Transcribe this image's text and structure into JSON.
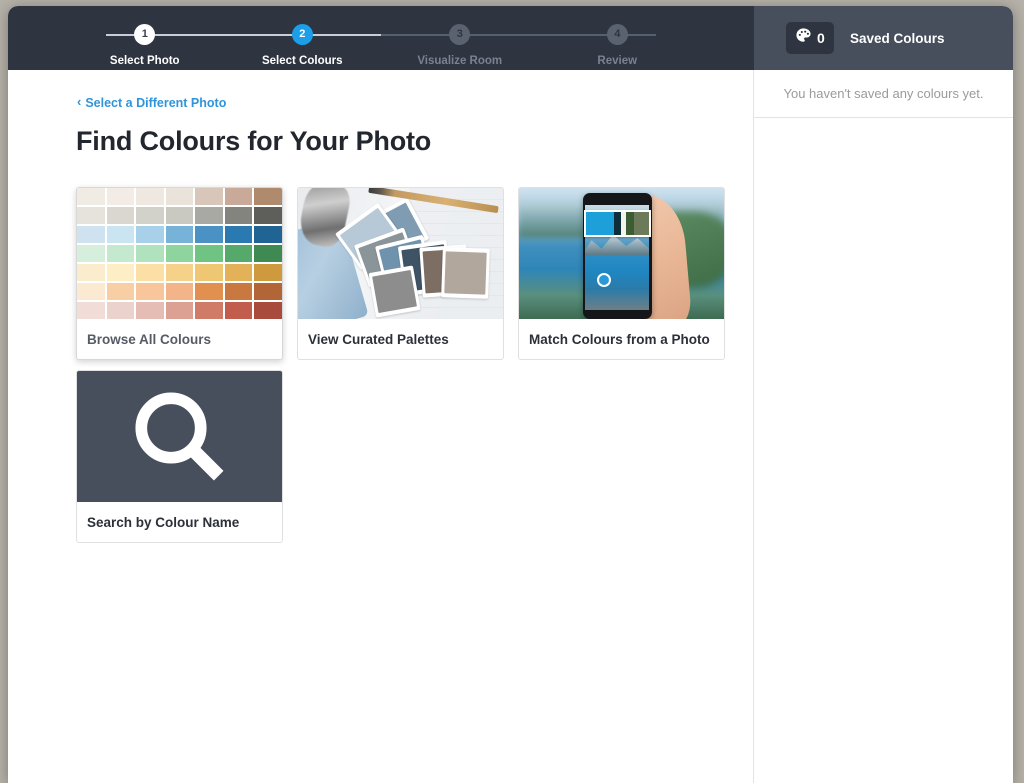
{
  "stepper": {
    "steps": [
      {
        "number": "1",
        "label": "Select Photo",
        "state": "done"
      },
      {
        "number": "2",
        "label": "Select Colours",
        "state": "active"
      },
      {
        "number": "3",
        "label": "Visualize Room",
        "state": "todo"
      },
      {
        "number": "4",
        "label": "Review",
        "state": "todo"
      }
    ],
    "active_color": "#1c9fe8"
  },
  "saved_panel": {
    "icon": "palette-icon",
    "count": "0",
    "title": "Saved Colours",
    "empty_message": "You haven't saved any colours yet."
  },
  "main": {
    "back_link": {
      "chevron": "‹",
      "label": "Select a Different Photo"
    },
    "title": "Find Colours for Your Photo",
    "cards": [
      {
        "id": "browse-all-colours",
        "label": "Browse All Colours",
        "thumb": "colour-swatch-grid",
        "hovered": true
      },
      {
        "id": "view-curated-palettes",
        "label": "View Curated Palettes",
        "thumb": "paint-swatch-fan-photo",
        "hovered": false
      },
      {
        "id": "match-colours-from-a-photo",
        "label": "Match Colours from a Photo",
        "thumb": "phone-colour-match-photo",
        "hovered": false
      },
      {
        "id": "search-by-colour-name",
        "label": "Search by Colour Name",
        "thumb": "magnifier-icon",
        "hovered": false
      }
    ]
  },
  "swatch_grid": {
    "columns": 7,
    "rows": [
      [
        "#f0ece3",
        "#f3ece6",
        "#efe8e0",
        "#eae3da",
        "#d8c6bb",
        "#c9aa99",
        "#b08a6d"
      ],
      [
        "#e6e3dc",
        "#d9d7d0",
        "#d2d1ca",
        "#c9c9c2",
        "#a9a9a4",
        "#84847f",
        "#5e5e5b"
      ],
      [
        "#cfe2ef",
        "#cbe4f2",
        "#a8d0e8",
        "#77b2d8",
        "#4a92c4",
        "#2a79b0",
        "#1f6492"
      ],
      [
        "#d6efdc",
        "#c4e9cf",
        "#b0e3bd",
        "#8ed49f",
        "#6fc383",
        "#55a96a",
        "#3f8a52"
      ],
      [
        "#fbeccd",
        "#fdeec6",
        "#fbdfa4",
        "#f5d189",
        "#efc672",
        "#e3b157",
        "#cf9a3d"
      ],
      [
        "#fbe9d2",
        "#f8cfa5",
        "#f8c69a",
        "#f2b488",
        "#e2904f",
        "#c97840",
        "#b26536"
      ],
      [
        "#f2dcd8",
        "#ecd2cc",
        "#e6bdb5",
        "#dda193",
        "#d07a68",
        "#c25c4c",
        "#a84a3c"
      ]
    ]
  },
  "palette_photo": {
    "fan_swatches": [
      "#7f9cb3",
      "#b7c9d6",
      "#8a959a",
      "#cfdde6",
      "#6f93ad",
      "#3e5366",
      "#7c6e63",
      "#4b433d",
      "#b2a79c",
      "#8d8d8d"
    ]
  },
  "phone_photo": {
    "extracted_swatches": [
      "#1d9fd9",
      "#0e2f3a",
      "#f2f2ef",
      "#3c5c34",
      "#6d7a5a"
    ]
  },
  "colors": {
    "stepper_bar": "#2e3440",
    "side_header": "#474e5c",
    "link_blue": "#2e95db",
    "search_tile": "#474e5c"
  }
}
